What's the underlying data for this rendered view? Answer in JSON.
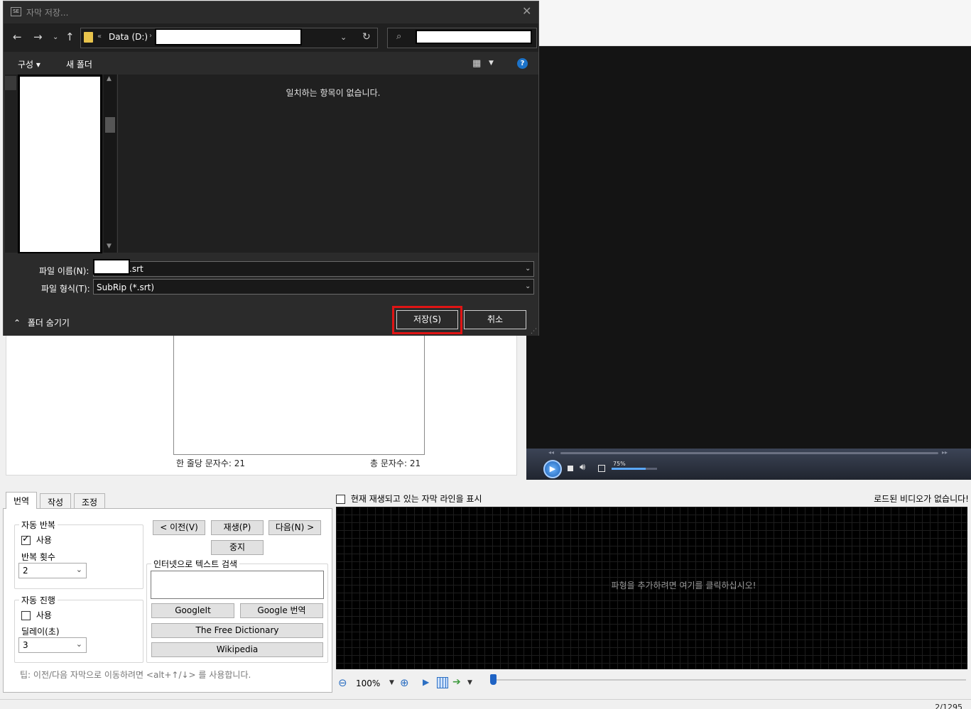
{
  "dialog": {
    "title": "자막 저장...",
    "address": {
      "chevrons": "«",
      "drive": "Data (D:)",
      "separator": "›"
    },
    "toolbar": {
      "organize": "구성 ▾",
      "new_folder": "새 폴더",
      "help": "?"
    },
    "empty_message": "일치하는 항목이 없습니다.",
    "file_name_label": "파일 이름(N):",
    "file_name_ext": ".srt",
    "file_type_label": "파일 형식(T):",
    "file_type_value": "SubRip (*.srt)",
    "hide_folders": "폴더 숨기기",
    "save_button": "저장(S)",
    "cancel_button": "취소",
    "highlight_color": "#e01414"
  },
  "editor": {
    "chars_per_line": "한 줄당 문자수: 21",
    "total_chars": "총 문자수: 21"
  },
  "video_player": {
    "volume_label": "75%",
    "volume_level": 0.75
  },
  "tabs": [
    {
      "label": "번역"
    },
    {
      "label": "작성"
    },
    {
      "label": "조정"
    }
  ],
  "translate_panel": {
    "auto_repeat": {
      "title": "자동 반복",
      "use_label": "사용",
      "use_checked": true,
      "count_label": "반복 횟수",
      "count_value": "2"
    },
    "auto_continue": {
      "title": "자동 진행",
      "use_label": "사용",
      "use_checked": false,
      "delay_label": "딜레이(초)",
      "delay_value": "3"
    },
    "prev_button": "< 이전(V)",
    "play_button": "재생(P)",
    "next_button": "다음(N) >",
    "stop_button": "중지",
    "search_group_title": "인터넷으로 텍스트 검색",
    "googleit_button": "GoogleIt",
    "google_translate_button": "Google 번역",
    "free_dictionary_button": "The Free Dictionary",
    "wikipedia_button": "Wikipedia",
    "tip": "팁: 이전/다음 자막으로 이동하려면 <alt+↑/↓> 를 사용합니다."
  },
  "waveform": {
    "show_current_line_label": "현재 재생되고 있는 자막 라인을 표시",
    "no_video_label": "로드된 비디오가 없습니다!",
    "message": "파형을 추가하려면 여기를 클릭하십시오!",
    "zoom": "100%"
  },
  "status": {
    "count": "2/1295"
  }
}
